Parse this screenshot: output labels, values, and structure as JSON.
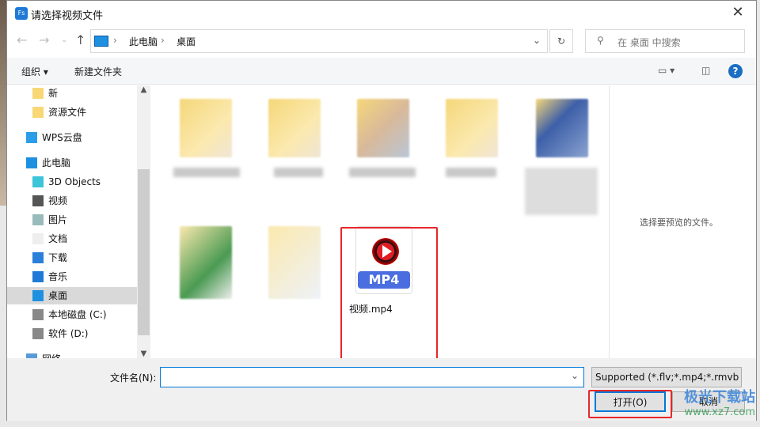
{
  "window": {
    "title": "请选择视频文件",
    "app_icon": "Fs"
  },
  "address": {
    "crumbs": [
      "此电脑",
      "桌面"
    ],
    "search_placeholder": "在 桌面 中搜索"
  },
  "toolbar": {
    "organize": "组织",
    "new_folder": "新建文件夹"
  },
  "nav": [
    {
      "label": "新",
      "icon": "folder-icon"
    },
    {
      "label": "资源文件",
      "icon": "folder-icon"
    },
    {
      "label": "WPS云盘",
      "icon": "cloud-icon"
    },
    {
      "label": "此电脑",
      "icon": "computer-icon"
    },
    {
      "label": "3D Objects",
      "icon": "cube-icon"
    },
    {
      "label": "视频",
      "icon": "video-icon"
    },
    {
      "label": "图片",
      "icon": "picture-icon"
    },
    {
      "label": "文档",
      "icon": "document-icon"
    },
    {
      "label": "下载",
      "icon": "download-icon"
    },
    {
      "label": "音乐",
      "icon": "music-icon"
    },
    {
      "label": "桌面",
      "icon": "desktop-icon",
      "selected": true
    },
    {
      "label": "本地磁盘 (C:)",
      "icon": "drive-icon"
    },
    {
      "label": "软件 (D:)",
      "icon": "drive-icon"
    },
    {
      "label": "网络",
      "icon": "network-icon"
    }
  ],
  "files": {
    "mp4_badge": "MP4",
    "mp4_name": "视频.mp4"
  },
  "preview": {
    "text": "选择要预览的文件。"
  },
  "bottom": {
    "filename_label": "文件名(N):",
    "filename_value": "",
    "filter": "Supported (*.flv;*.mp4;*.rmvb",
    "open": "打开(O)",
    "cancel": "取消"
  },
  "watermark": {
    "name": "极光下载站",
    "url": "www.xz7.com"
  },
  "colors": {
    "highlight": "#e8262a",
    "selection": "#d9d9d9",
    "accent": "#0078d7"
  }
}
